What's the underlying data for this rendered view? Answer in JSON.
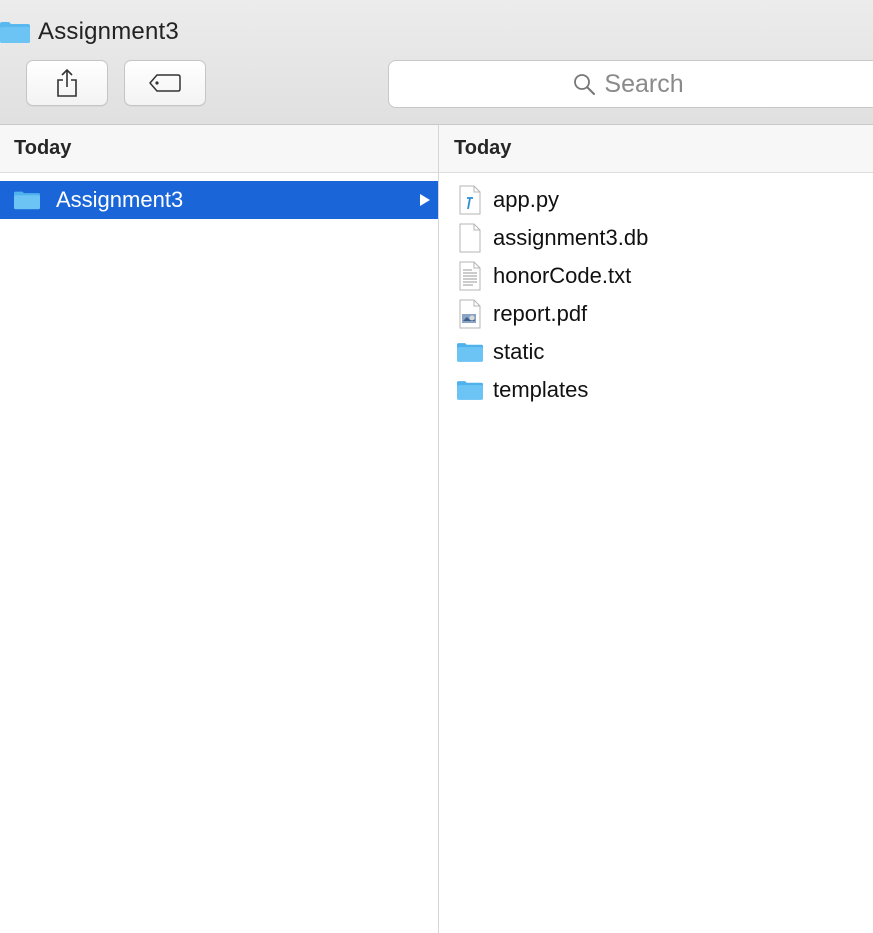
{
  "window": {
    "title": "Assignment3"
  },
  "toolbar": {
    "share_icon": "share-icon",
    "tag_icon": "tag-icon",
    "search_placeholder": "Search",
    "search_icon": "search-icon"
  },
  "columns": [
    {
      "header": "Today",
      "items": [
        {
          "name": "Assignment3",
          "kind": "folder",
          "selected": true,
          "has_children": true
        }
      ]
    },
    {
      "header": "Today",
      "items": [
        {
          "name": "app.py",
          "kind": "python-file"
        },
        {
          "name": "assignment3.db",
          "kind": "blank-file"
        },
        {
          "name": "honorCode.txt",
          "kind": "text-file"
        },
        {
          "name": "report.pdf",
          "kind": "pdf-file"
        },
        {
          "name": "static",
          "kind": "folder",
          "has_children": true
        },
        {
          "name": "templates",
          "kind": "folder",
          "has_children": true
        }
      ]
    }
  ],
  "colors": {
    "selection": "#1a66d9",
    "folder_blue": "#6cc4f5"
  }
}
